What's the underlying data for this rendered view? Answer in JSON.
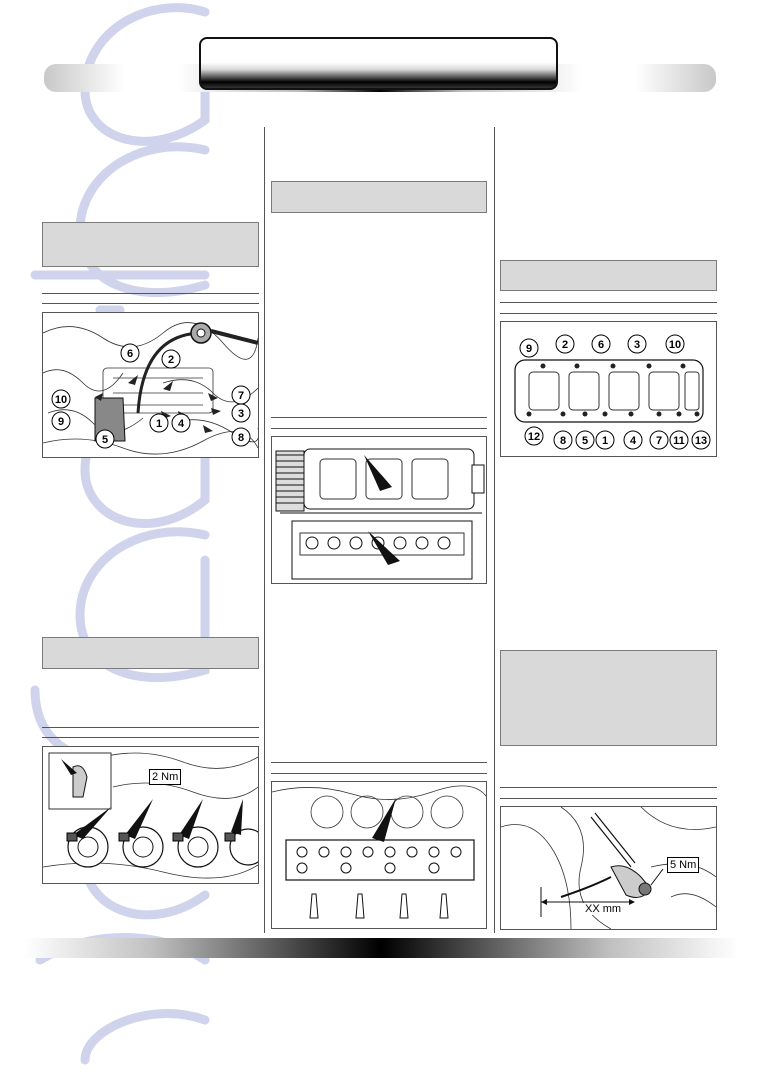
{
  "header": {
    "title": ""
  },
  "figures": {
    "fig1": {
      "labels": [
        "6",
        "2",
        "7",
        "10",
        "3",
        "9",
        "5",
        "1",
        "4",
        "8"
      ]
    },
    "fig2": {
      "torque": "2 Nm"
    },
    "fig5": {
      "labels": [
        "9",
        "2",
        "6",
        "3",
        "10",
        "12",
        "8",
        "5",
        "1",
        "4",
        "7",
        "11",
        "13"
      ]
    },
    "fig6": {
      "torque": "5 Nm",
      "dimension": "XX mm"
    }
  },
  "colors": {
    "watermark": "#cfd3ec",
    "graybox": "#d9d9d9",
    "rule": "#555555"
  }
}
